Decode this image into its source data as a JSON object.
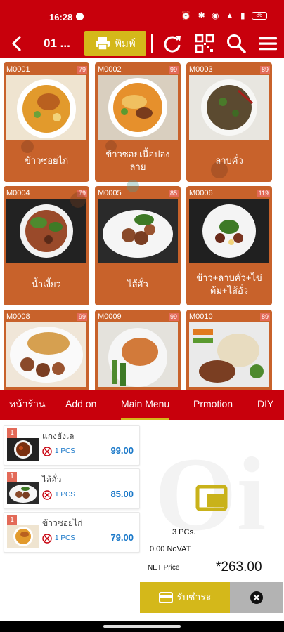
{
  "status_bar": {
    "time": "16:28",
    "battery": "86"
  },
  "toolbar": {
    "table_label": "01 ...",
    "print_label": "พิมพ์"
  },
  "menu_items": [
    {
      "code": "M0001",
      "qty": "79",
      "name": "ข้าวซอยไก่"
    },
    {
      "code": "M0002",
      "qty": "99",
      "name": "ข้าวซอยเนื้อปองลาย"
    },
    {
      "code": "M0003",
      "qty": "89",
      "name": "ลาบคั่ว"
    },
    {
      "code": "M0004",
      "qty": "79",
      "name": "น้ำเงี้ยว"
    },
    {
      "code": "M0005",
      "qty": "85",
      "name": "ไส้อั่ว"
    },
    {
      "code": "M0006",
      "qty": "119",
      "name": "ข้าว+ลาบคั่ว+ไข่ต้ม+ไส้อั่ว"
    },
    {
      "code": "M0008",
      "qty": "99",
      "name": ""
    },
    {
      "code": "M0009",
      "qty": "99",
      "name": ""
    },
    {
      "code": "M0010",
      "qty": "89",
      "name": ""
    }
  ],
  "tabs": [
    {
      "label": "หน้าร้าน",
      "active": false
    },
    {
      "label": "Add on",
      "active": false
    },
    {
      "label": "Main Menu",
      "active": true
    },
    {
      "label": "Prmotion",
      "active": false
    },
    {
      "label": "DIY",
      "active": false
    }
  ],
  "order": {
    "watermark": "Oi",
    "items": [
      {
        "count": "1",
        "name": "แกงฮังเล",
        "pcs": "1 PCS",
        "price": "99.00"
      },
      {
        "count": "1",
        "name": "ไส้อั่ว",
        "pcs": "1 PCS",
        "price": "85.00"
      },
      {
        "count": "1",
        "name": "ข้าวซอยไก่",
        "pcs": "1 PCS",
        "price": "79.00"
      }
    ],
    "total_pcs": "3 PCs.",
    "vat": "0.00 NoVAT",
    "net_label": "NET Price",
    "net_value": "*263.00",
    "pay_label": "รับชำระ"
  },
  "colors": {
    "primary": "#c8000c",
    "card": "#c8622b",
    "accent": "#d4b81a",
    "price": "#1877c8"
  }
}
